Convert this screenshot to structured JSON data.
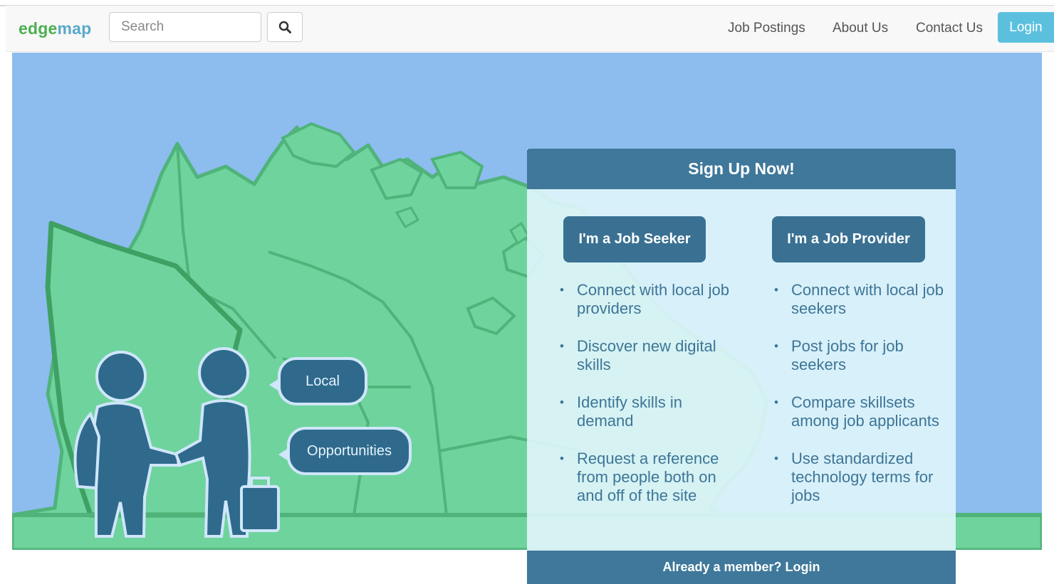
{
  "navbar": {
    "brand": {
      "part1": "edge",
      "part2": "map"
    },
    "search": {
      "placeholder": "Search",
      "button_icon": "search-icon"
    },
    "links": [
      "Job Postings",
      "About Us",
      "Contact Us"
    ],
    "login_label": "Login"
  },
  "hero": {
    "bubbles": [
      "Local",
      "Opportunities"
    ]
  },
  "signup": {
    "title": "Sign Up Now!",
    "seeker": {
      "button_label": "I'm a Job Seeker",
      "items": [
        "Connect with local job providers",
        "Discover new digital skills",
        "Identify skills in demand",
        "Request a reference from people both on and off of the site"
      ]
    },
    "provider": {
      "button_label": "I'm a Job Provider",
      "items": [
        "Connect with local job seekers",
        "Post jobs for job seekers",
        "Compare skillsets among job applicants",
        "Use standardized technology terms for jobs"
      ]
    },
    "footer": "Already a member? Login"
  },
  "colors": {
    "brand_green": "#4caf50",
    "hero_bg": "#8dbcef",
    "panel_header": "#3f789a",
    "login_btn": "#5bc0de"
  }
}
